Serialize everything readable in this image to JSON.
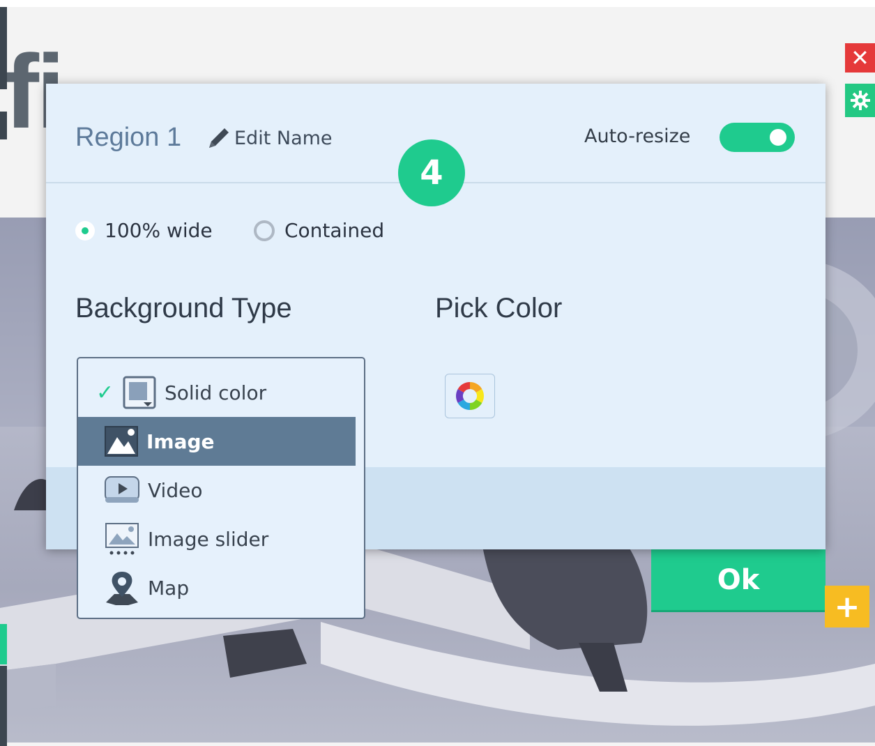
{
  "background_page": {
    "title_fragment": "fi",
    "close_icon": "close-icon",
    "settings_icon": "gear-icon",
    "ok_label": "Ok",
    "add_icon": "plus-icon"
  },
  "modal": {
    "region_title": "Region 1",
    "edit_name_label": "Edit Name",
    "auto_resize_label": "Auto-resize",
    "auto_resize_on": true,
    "step_number": "4",
    "width_options": [
      {
        "label": "100% wide",
        "selected": true
      },
      {
        "label": "Contained",
        "selected": false
      }
    ],
    "background_type_title": "Background Type",
    "pick_color_title": "Pick Color",
    "background_types": [
      {
        "label": "Solid color",
        "icon": "solid-color-icon",
        "checked": true,
        "highlighted": false
      },
      {
        "label": "Image",
        "icon": "image-icon",
        "checked": false,
        "highlighted": true
      },
      {
        "label": "Video",
        "icon": "video-icon",
        "checked": false,
        "highlighted": false
      },
      {
        "label": "Image slider",
        "icon": "image-slider-icon",
        "checked": false,
        "highlighted": false
      },
      {
        "label": "Map",
        "icon": "map-pin-icon",
        "checked": false,
        "highlighted": false
      }
    ],
    "colors": {
      "accent": "#1fcb8e",
      "highlight": "#5f7b95",
      "modal_bg": "#e4f0fb"
    }
  }
}
